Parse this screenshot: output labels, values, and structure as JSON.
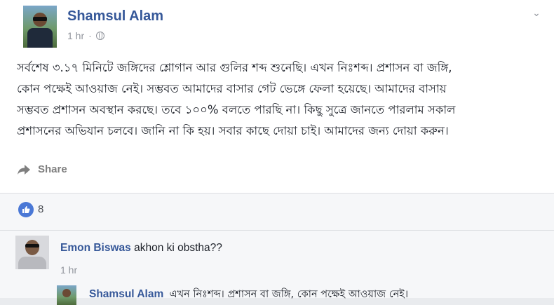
{
  "post": {
    "author": "Shamsul Alam",
    "time": "1 hr",
    "privacy_icon": "globe-icon",
    "menu_icon": "chevron-down-icon",
    "text_lines": [
      "সর্বশেষ ৩.১৭ মিনিটে জঙ্গিদের শ্লোগান আর গুলির শব্দ শুনেছি। এখন নিঃশব্দ। প্রশাসন বা জঙ্গি,",
      "কোন পক্ষেই আওয়াজ নেই। সম্ভবত আমাদের বাসার গেট ভেঙ্গে ফেলা হয়েছে। আমাদের বাসায়",
      "সম্ভবত প্রশাসন অবস্থান করছে। তবে ১০০% বলতে পারছি না। কিছু সুত্রে জানতে পারলাম সকাল",
      "প্রশাসনের অভিযান চলবে। জানি না কি হয়। সবার কাছে দোয়া চাই। আমাদের জন্য দোয়া করুন।"
    ],
    "share_label": "Share",
    "share_icon": "share-arrow-icon"
  },
  "reactions": {
    "icon": "like-icon",
    "count": "8",
    "color": "#4a78d6"
  },
  "comments": [
    {
      "author": "Emon Biswas",
      "text": "akhon ki obstha??",
      "time": "1 hr"
    }
  ],
  "reply": {
    "author": "Shamsul Alam",
    "text": "এখন নিঃশব্দ। প্রশাসন বা জঙ্গি, কোন পক্ষেই আওয়াজ নেই।"
  },
  "colors": {
    "link": "#365899",
    "meta": "#90949c",
    "panel": "#f6f7f9"
  }
}
